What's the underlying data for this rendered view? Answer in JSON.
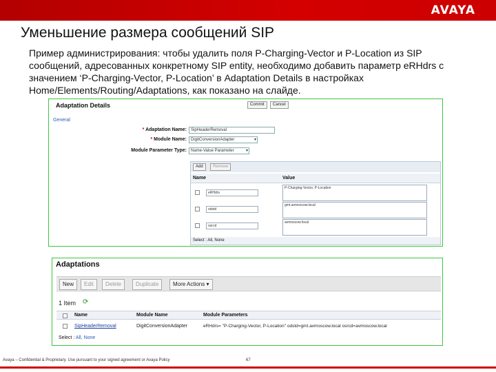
{
  "brand": {
    "logo_text": "AVAYA",
    "accent": "#cc0000"
  },
  "slide": {
    "title": "Уменьшение размера сообщений SIP",
    "paragraph": "Пример администрирования: чтобы удалить поля P-Charging-Vector и P-Location из SIP сообщений, адресованных конкретному SIP entity, необходимо добавить параметр eRHdrs с значением ‘P-Charging-Vector, P-Location’ в Adaptation Details в настройках Home/Elements/Routing/Adaptations, как показано на слайде.",
    "footer": "Avaya – Confidential & Proprietary. Use pursuant to your signed agreement or Avaya Policy",
    "page_number": "67"
  },
  "adaptation_details": {
    "title": "Adaptation Details",
    "commit_label": "Commit",
    "cancel_label": "Cancel",
    "section": "General",
    "fields": {
      "name_label": "Adaptation Name:",
      "name_value": "SipHeaderRemoval",
      "module_label": "Module Name:",
      "module_value": "DigitConversionAdapter",
      "param_type_label": "Module Parameter Type:",
      "param_type_value": "Name-Value Parameter"
    },
    "grid": {
      "add_label": "Add",
      "remove_label": "Remove",
      "col_name": "Name",
      "col_value": "Value",
      "rows": [
        {
          "name": "eRHdrs",
          "value": "P-Charging-Vector, P-Location"
        },
        {
          "name": "odstd",
          "value": "gmt.avmoscow.local"
        },
        {
          "name": "osrcd",
          "value": "avmoscow.local"
        }
      ],
      "select_text": "Select : All, None"
    }
  },
  "adaptations": {
    "title": "Adaptations",
    "toolbar": {
      "new": "New",
      "edit": "Edit",
      "delete": "Delete",
      "duplicate": "Duplicate",
      "more_actions": "More Actions"
    },
    "items_count": "1 Item",
    "columns": {
      "name": "Name",
      "module_name": "Module Name",
      "module_parameters": "Module Parameters"
    },
    "rows": [
      {
        "name": "SipHeaderRemoval",
        "module_name": "DigitConversionAdapter",
        "module_parameters": "eRHdrs= \"P-Charging-Vector, P-Location\" odstd=gmt.avmoscow.local osrcd=avmoscow.local"
      }
    ],
    "select_label": "Select :",
    "select_links": "All, None"
  }
}
